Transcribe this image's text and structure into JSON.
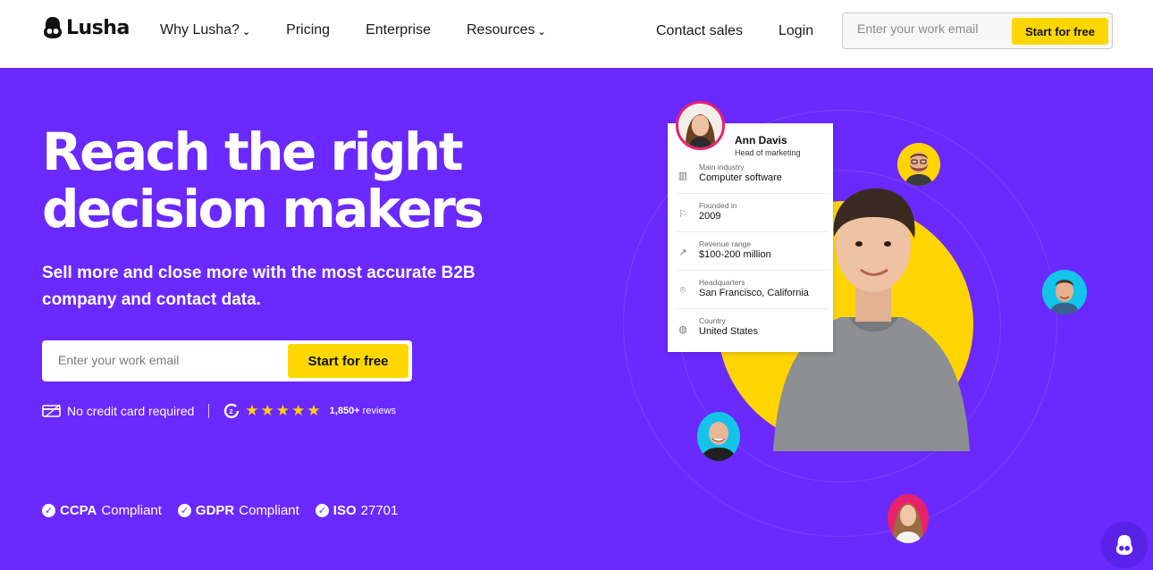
{
  "nav": {
    "logo": "Lusha",
    "links": [
      {
        "label": "Why Lusha?",
        "dropdown": true
      },
      {
        "label": "Pricing",
        "dropdown": false
      },
      {
        "label": "Enterprise",
        "dropdown": false
      },
      {
        "label": "Resources",
        "dropdown": true
      }
    ],
    "contact_sales": "Contact sales",
    "login": "Login",
    "email_placeholder": "Enter your work email",
    "cta": "Start for free"
  },
  "hero": {
    "title_line1": "Reach the right",
    "title_line2": "decision makers",
    "subtitle": "Sell more and close more with the most accurate B2B company and contact data.",
    "email_placeholder": "Enter your work email",
    "cta": "Start for free",
    "no_credit_card": "No credit card required",
    "rating_stars": 5,
    "reviews_count": "1,850+",
    "reviews_label": "reviews"
  },
  "compliance": [
    {
      "bold": "CCPA",
      "text": "Compliant"
    },
    {
      "bold": "GDPR",
      "text": "Compliant"
    },
    {
      "bold": "ISO",
      "text": "27701"
    }
  ],
  "profile_card": {
    "name": "Ann Davis",
    "role": "Head of marketing",
    "rows": [
      {
        "icon": "building-icon",
        "label": "Main industry",
        "value": "Computer software"
      },
      {
        "icon": "flag-icon",
        "label": "Founded in",
        "value": "2009"
      },
      {
        "icon": "trend-icon",
        "label": "Revenue range",
        "value": "$100-200 million"
      },
      {
        "icon": "location-pin-icon",
        "label": "Headquarters",
        "value": "San Francisco, California"
      },
      {
        "icon": "globe-icon",
        "label": "Country",
        "value": "United States"
      }
    ]
  },
  "colors": {
    "background": "#6a29ff",
    "accent": "#ffd700",
    "text_light": "#ffffff"
  }
}
